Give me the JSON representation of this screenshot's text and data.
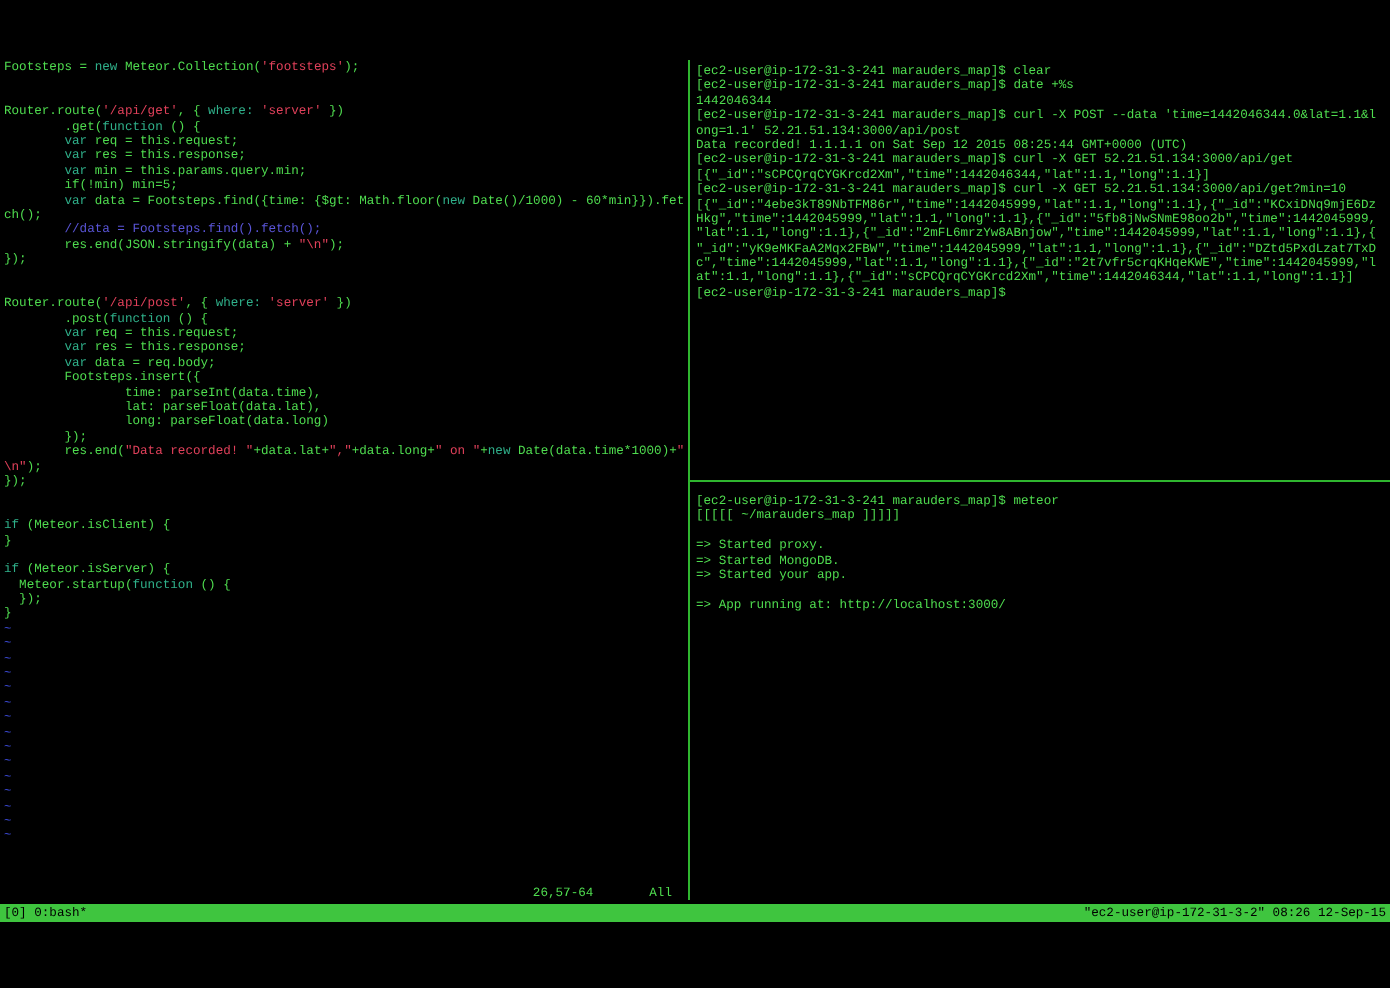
{
  "editor": {
    "lines": [
      {
        "kind": "code",
        "segments": [
          {
            "kind": "plain",
            "text": "Footsteps = "
          },
          {
            "kind": "keyword",
            "text": "new"
          },
          {
            "kind": "plain",
            "text": " Meteor.Collection("
          },
          {
            "kind": "string",
            "text": "'footsteps'"
          },
          {
            "kind": "plain",
            "text": ");"
          }
        ]
      },
      {
        "kind": "blank"
      },
      {
        "kind": "blank"
      },
      {
        "kind": "code",
        "segments": [
          {
            "kind": "plain",
            "text": "Router.route("
          },
          {
            "kind": "string",
            "text": "'/api/get'"
          },
          {
            "kind": "plain",
            "text": ", { "
          },
          {
            "kind": "keyword",
            "text": "where: "
          },
          {
            "kind": "string",
            "text": "'server'"
          },
          {
            "kind": "plain",
            "text": " })"
          }
        ]
      },
      {
        "kind": "code",
        "segments": [
          {
            "kind": "plain",
            "text": "        .get("
          },
          {
            "kind": "keyword",
            "text": "function"
          },
          {
            "kind": "plain",
            "text": " () {"
          }
        ]
      },
      {
        "kind": "code",
        "segments": [
          {
            "kind": "keyword",
            "text": "        var"
          },
          {
            "kind": "plain",
            "text": " req = this.request;"
          }
        ]
      },
      {
        "kind": "code",
        "segments": [
          {
            "kind": "keyword",
            "text": "        var"
          },
          {
            "kind": "plain",
            "text": " res = this.response;"
          }
        ]
      },
      {
        "kind": "code",
        "segments": [
          {
            "kind": "keyword",
            "text": "        var"
          },
          {
            "kind": "plain",
            "text": " min = this.params.query.min;"
          }
        ]
      },
      {
        "kind": "code",
        "segments": [
          {
            "kind": "plain",
            "text": "        if(!min) min=5;"
          }
        ]
      },
      {
        "kind": "code",
        "segments": [
          {
            "kind": "keyword",
            "text": "        var"
          },
          {
            "kind": "plain",
            "text": " data = Footsteps.find({time: {$gt: Math.floor("
          },
          {
            "kind": "keyword",
            "text": "new"
          },
          {
            "kind": "plain",
            "text": " Date()/1000) - 60*min}}).fet"
          }
        ]
      },
      {
        "kind": "code",
        "segments": [
          {
            "kind": "plain",
            "text": "ch();"
          }
        ]
      },
      {
        "kind": "code",
        "segments": [
          {
            "kind": "comment",
            "text": "        //data = Footsteps.find().fetch();"
          }
        ]
      },
      {
        "kind": "code",
        "segments": [
          {
            "kind": "plain",
            "text": "        res.end(JSON.stringify(data) + "
          },
          {
            "kind": "string",
            "text": "\"\\n\""
          },
          {
            "kind": "plain",
            "text": ");"
          }
        ]
      },
      {
        "kind": "code",
        "segments": [
          {
            "kind": "plain",
            "text": "});"
          }
        ]
      },
      {
        "kind": "blank"
      },
      {
        "kind": "blank"
      },
      {
        "kind": "code",
        "segments": [
          {
            "kind": "plain",
            "text": "Router.route("
          },
          {
            "kind": "string",
            "text": "'/api/post'"
          },
          {
            "kind": "plain",
            "text": ", { "
          },
          {
            "kind": "keyword",
            "text": "where: "
          },
          {
            "kind": "string",
            "text": "'server'"
          },
          {
            "kind": "plain",
            "text": " })"
          }
        ]
      },
      {
        "kind": "code",
        "segments": [
          {
            "kind": "plain",
            "text": "        .post("
          },
          {
            "kind": "keyword",
            "text": "function"
          },
          {
            "kind": "plain",
            "text": " () {"
          }
        ]
      },
      {
        "kind": "code",
        "segments": [
          {
            "kind": "keyword",
            "text": "        var"
          },
          {
            "kind": "plain",
            "text": " req = this.request;"
          }
        ]
      },
      {
        "kind": "code",
        "segments": [
          {
            "kind": "keyword",
            "text": "        var"
          },
          {
            "kind": "plain",
            "text": " res = this.response;"
          }
        ]
      },
      {
        "kind": "code",
        "segments": [
          {
            "kind": "keyword",
            "text": "        var"
          },
          {
            "kind": "plain",
            "text": " data = req.body;"
          }
        ]
      },
      {
        "kind": "code",
        "segments": [
          {
            "kind": "plain",
            "text": "        Footsteps.insert({"
          }
        ]
      },
      {
        "kind": "code",
        "segments": [
          {
            "kind": "plain",
            "text": "                time: parseInt(data.time),"
          }
        ]
      },
      {
        "kind": "code",
        "segments": [
          {
            "kind": "plain",
            "text": "                lat: parseFloat(data.lat),"
          }
        ]
      },
      {
        "kind": "code",
        "segments": [
          {
            "kind": "plain",
            "text": "                long: parseFloat(data.long)"
          }
        ]
      },
      {
        "kind": "code",
        "segments": [
          {
            "kind": "plain",
            "text": "        });"
          }
        ]
      },
      {
        "kind": "code",
        "segments": [
          {
            "kind": "plain",
            "text": "        res.end("
          },
          {
            "kind": "string",
            "text": "\"Data recorded! \""
          },
          {
            "kind": "plain",
            "text": "+data.lat+"
          },
          {
            "kind": "string",
            "text": "\",\""
          },
          {
            "kind": "plain",
            "text": "+data.long+"
          },
          {
            "kind": "string",
            "text": "\" on \""
          },
          {
            "kind": "plain",
            "text": "+"
          },
          {
            "kind": "keyword",
            "text": "new"
          },
          {
            "kind": "plain",
            "text": " Date(data.time*1000)+"
          },
          {
            "kind": "string",
            "text": "\""
          }
        ]
      },
      {
        "kind": "code",
        "segments": [
          {
            "kind": "string",
            "text": "\\n\""
          },
          {
            "kind": "plain",
            "text": ");"
          }
        ]
      },
      {
        "kind": "code",
        "segments": [
          {
            "kind": "plain",
            "text": "});"
          }
        ]
      },
      {
        "kind": "blank"
      },
      {
        "kind": "blank"
      },
      {
        "kind": "code",
        "segments": [
          {
            "kind": "keyword",
            "text": "if"
          },
          {
            "kind": "plain",
            "text": " (Meteor.isClient) {"
          }
        ]
      },
      {
        "kind": "code",
        "segments": [
          {
            "kind": "plain",
            "text": "}"
          }
        ]
      },
      {
        "kind": "blank"
      },
      {
        "kind": "code",
        "segments": [
          {
            "kind": "keyword",
            "text": "if"
          },
          {
            "kind": "plain",
            "text": " (Meteor.isServer) {"
          }
        ]
      },
      {
        "kind": "code",
        "segments": [
          {
            "kind": "plain",
            "text": "  Meteor.startup("
          },
          {
            "kind": "keyword",
            "text": "function"
          },
          {
            "kind": "plain",
            "text": " () {"
          }
        ]
      },
      {
        "kind": "code",
        "segments": [
          {
            "kind": "plain",
            "text": "  });"
          }
        ]
      },
      {
        "kind": "code",
        "segments": [
          {
            "kind": "plain",
            "text": "}"
          }
        ]
      },
      {
        "kind": "filler",
        "text": "~"
      },
      {
        "kind": "filler",
        "text": "~"
      },
      {
        "kind": "filler",
        "text": "~"
      },
      {
        "kind": "filler",
        "text": "~"
      },
      {
        "kind": "filler",
        "text": "~"
      },
      {
        "kind": "filler",
        "text": "~"
      },
      {
        "kind": "filler",
        "text": "~"
      },
      {
        "kind": "filler",
        "text": "~"
      },
      {
        "kind": "filler",
        "text": "~"
      },
      {
        "kind": "filler",
        "text": "~"
      },
      {
        "kind": "filler",
        "text": "~"
      },
      {
        "kind": "filler",
        "text": "~"
      },
      {
        "kind": "filler",
        "text": "~"
      },
      {
        "kind": "filler",
        "text": "~"
      },
      {
        "kind": "filler",
        "text": "~"
      }
    ],
    "status": {
      "position": "26,57-64",
      "scroll": "All"
    }
  },
  "terminal_top": {
    "lines": [
      {
        "kind": "output",
        "text": "[ec2-user@ip-172-31-3-241 marauders_map]$ clear"
      },
      {
        "kind": "output",
        "text": "[ec2-user@ip-172-31-3-241 marauders_map]$ date +%s"
      },
      {
        "kind": "output",
        "text": "1442046344"
      },
      {
        "kind": "output",
        "text": "[ec2-user@ip-172-31-3-241 marauders_map]$ curl -X POST --data 'time=1442046344.0&lat=1.1&l"
      },
      {
        "kind": "output",
        "text": "ong=1.1' 52.21.51.134:3000/api/post"
      },
      {
        "kind": "output",
        "text": "Data recorded! 1.1.1.1 on Sat Sep 12 2015 08:25:44 GMT+0000 (UTC)"
      },
      {
        "kind": "output",
        "text": "[ec2-user@ip-172-31-3-241 marauders_map]$ curl -X GET 52.21.51.134:3000/api/get"
      },
      {
        "kind": "output",
        "text": "[{\"_id\":\"sCPCQrqCYGKrcd2Xm\",\"time\":1442046344,\"lat\":1.1,\"long\":1.1}]"
      },
      {
        "kind": "output",
        "text": "[ec2-user@ip-172-31-3-241 marauders_map]$ curl -X GET 52.21.51.134:3000/api/get?min=10"
      },
      {
        "kind": "output",
        "text": "[{\"_id\":\"4ebe3kT89NbTFM86r\",\"time\":1442045999,\"lat\":1.1,\"long\":1.1},{\"_id\":\"KCxiDNq9mjE6Dz"
      },
      {
        "kind": "output",
        "text": "Hkg\",\"time\":1442045999,\"lat\":1.1,\"long\":1.1},{\"_id\":\"5fb8jNwSNmE98oo2b\",\"time\":1442045999,"
      },
      {
        "kind": "output",
        "text": "\"lat\":1.1,\"long\":1.1},{\"_id\":\"2mFL6mrzYw8ABnjow\",\"time\":1442045999,\"lat\":1.1,\"long\":1.1},{"
      },
      {
        "kind": "output",
        "text": "\"_id\":\"yK9eMKFaA2Mqx2FBW\",\"time\":1442045999,\"lat\":1.1,\"long\":1.1},{\"_id\":\"DZtd5PxdLzat7TxD"
      },
      {
        "kind": "output",
        "text": "c\",\"time\":1442045999,\"lat\":1.1,\"long\":1.1},{\"_id\":\"2t7vfr5crqKHqeKWE\",\"time\":1442045999,\"l"
      },
      {
        "kind": "output",
        "text": "at\":1.1,\"long\":1.1},{\"_id\":\"sCPCQrqCYGKrcd2Xm\",\"time\":1442046344,\"lat\":1.1,\"long\":1.1}]"
      },
      {
        "kind": "output",
        "text": "[ec2-user@ip-172-31-3-241 marauders_map]$"
      }
    ]
  },
  "terminal_bottom": {
    "lines": [
      {
        "kind": "output",
        "text": "[ec2-user@ip-172-31-3-241 marauders_map]$ meteor"
      },
      {
        "kind": "output",
        "text": "[[[[[ ~/marauders_map ]]]]]"
      },
      {
        "kind": "blank"
      },
      {
        "kind": "output",
        "text": "=> Started proxy."
      },
      {
        "kind": "output",
        "text": "=> Started MongoDB."
      },
      {
        "kind": "output",
        "text": "=> Started your app."
      },
      {
        "kind": "blank"
      },
      {
        "kind": "output",
        "text": "=> App running at: http://localhost:3000/"
      }
    ]
  },
  "status_bar": {
    "window": "[0] 0:bash*",
    "host": "\"ec2-user@ip-172-31-3-2\" 08:26 12-Sep-15"
  }
}
